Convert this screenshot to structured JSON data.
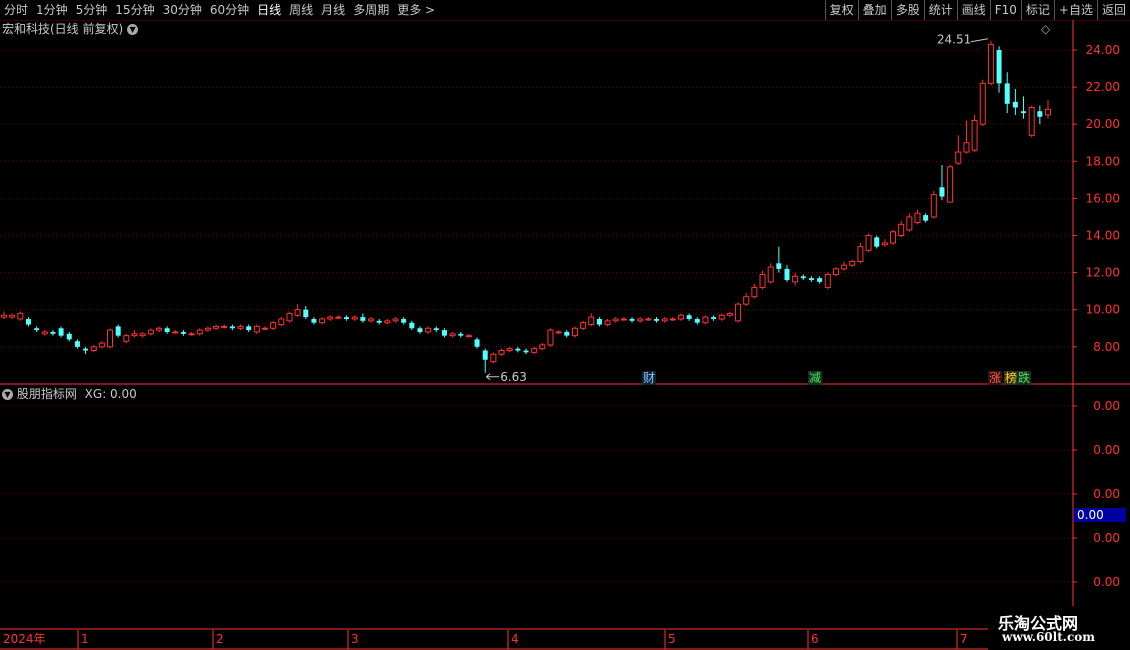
{
  "toolbar": {
    "left_items": [
      "分时",
      "1分钟",
      "5分钟",
      "15分钟",
      "30分钟",
      "60分钟",
      "日线",
      "周线",
      "月线",
      "多周期",
      "更多 >"
    ],
    "active": "日线",
    "right_items": [
      "复权",
      "叠加",
      "多股",
      "统计",
      "画线",
      "F10",
      "标记",
      "+自选",
      "返回"
    ]
  },
  "main_chart": {
    "title": "宏和科技(日线 前复权)",
    "title_icon": "chevron-down-icon",
    "corner_icon": "diamond-icon",
    "y_axis_labels": [
      "24.00",
      "22.00",
      "20.00",
      "18.00",
      "16.00",
      "14.00",
      "12.00",
      "10.00",
      "8.00"
    ],
    "high_label": "24.51",
    "low_label": "6.63",
    "badges": [
      {
        "text": "财",
        "color": "#7ec8ff"
      },
      {
        "text": "减",
        "color": "#55dd55"
      },
      {
        "text": "涨",
        "color": "#ff5555"
      },
      {
        "text": "榜",
        "color": "#ffcc33"
      },
      {
        "text": "跌",
        "color": "#55dd55"
      }
    ]
  },
  "indicator": {
    "title": "股朋指标网",
    "xg_label": "XG: 0.00",
    "y_axis_labels": [
      "0.00",
      "0.00",
      "0.00",
      "0.00",
      "0.00"
    ],
    "current_value": "0.00"
  },
  "time_axis": {
    "year": "2024年",
    "months": [
      "1",
      "2",
      "3",
      "4",
      "5",
      "6",
      "7"
    ]
  },
  "watermark": {
    "line1": "乐淘公式网",
    "line2": "www.60lt.com"
  },
  "colors": {
    "up": "#ff3232",
    "down": "#54ffff",
    "grid": "#8b0000",
    "axis": "#ff3232",
    "selected_bg": "#0000a0"
  },
  "chart_data": {
    "type": "candlestick",
    "title": "宏和科技(日线 前复权)",
    "ylim": [
      6.0,
      25.5
    ],
    "y_ticks": [
      8,
      10,
      12,
      14,
      16,
      18,
      20,
      22,
      24
    ],
    "annotations": [
      {
        "label": "24.51",
        "kind": "high"
      },
      {
        "label": "6.63",
        "kind": "low"
      }
    ],
    "candles": [
      [
        9.6,
        9.7,
        9.9,
        9.5
      ],
      [
        9.6,
        9.7,
        9.8,
        9.5
      ],
      [
        9.5,
        9.8,
        9.9,
        9.4
      ],
      [
        9.5,
        9.2,
        9.6,
        9.1
      ],
      [
        9.0,
        8.9,
        9.1,
        8.8
      ],
      [
        8.7,
        8.8,
        8.9,
        8.6
      ],
      [
        8.8,
        8.7,
        8.9,
        8.6
      ],
      [
        9.0,
        8.6,
        9.1,
        8.5
      ],
      [
        8.7,
        8.4,
        8.8,
        8.3
      ],
      [
        8.3,
        8.0,
        8.4,
        7.9
      ],
      [
        7.9,
        7.8,
        8.0,
        7.6
      ],
      [
        7.8,
        8.0,
        8.1,
        7.7
      ],
      [
        8.0,
        8.2,
        8.3,
        7.9
      ],
      [
        8.0,
        8.9,
        9.0,
        7.9
      ],
      [
        9.1,
        8.6,
        9.2,
        8.5
      ],
      [
        8.3,
        8.6,
        8.7,
        8.2
      ],
      [
        8.6,
        8.7,
        8.9,
        8.5
      ],
      [
        8.6,
        8.7,
        8.8,
        8.5
      ],
      [
        8.7,
        8.9,
        9.0,
        8.6
      ],
      [
        8.9,
        9.0,
        9.1,
        8.8
      ],
      [
        9.0,
        8.8,
        9.1,
        8.7
      ],
      [
        8.8,
        8.8,
        8.9,
        8.7
      ],
      [
        8.8,
        8.7,
        8.9,
        8.6
      ],
      [
        8.7,
        8.7,
        8.8,
        8.6
      ],
      [
        8.7,
        8.9,
        9.0,
        8.6
      ],
      [
        8.9,
        9.0,
        9.1,
        8.8
      ],
      [
        9.0,
        9.1,
        9.2,
        8.9
      ],
      [
        9.1,
        9.1,
        9.2,
        9.0
      ],
      [
        9.1,
        9.0,
        9.2,
        8.9
      ],
      [
        9.0,
        9.1,
        9.2,
        8.9
      ],
      [
        9.1,
        8.9,
        9.2,
        8.8
      ],
      [
        8.8,
        9.1,
        9.2,
        8.7
      ],
      [
        9.0,
        9.0,
        9.1,
        8.9
      ],
      [
        9.0,
        9.3,
        9.4,
        8.9
      ],
      [
        9.2,
        9.5,
        9.6,
        9.1
      ],
      [
        9.4,
        9.8,
        9.9,
        9.3
      ],
      [
        9.7,
        10.0,
        10.3,
        9.6
      ],
      [
        10.0,
        9.6,
        10.2,
        9.5
      ],
      [
        9.5,
        9.3,
        9.6,
        9.2
      ],
      [
        9.3,
        9.5,
        9.6,
        9.2
      ],
      [
        9.5,
        9.6,
        9.7,
        9.4
      ],
      [
        9.6,
        9.6,
        9.7,
        9.5
      ],
      [
        9.6,
        9.5,
        9.7,
        9.4
      ],
      [
        9.5,
        9.6,
        9.7,
        9.4
      ],
      [
        9.6,
        9.4,
        9.8,
        9.3
      ],
      [
        9.4,
        9.5,
        9.6,
        9.3
      ],
      [
        9.4,
        9.3,
        9.5,
        9.2
      ],
      [
        9.3,
        9.4,
        9.5,
        9.2
      ],
      [
        9.4,
        9.5,
        9.6,
        9.3
      ],
      [
        9.5,
        9.3,
        9.6,
        9.2
      ],
      [
        9.3,
        9.0,
        9.4,
        8.9
      ],
      [
        9.0,
        8.8,
        9.1,
        8.7
      ],
      [
        8.8,
        9.0,
        9.1,
        8.7
      ],
      [
        9.0,
        8.9,
        9.1,
        8.8
      ],
      [
        8.9,
        8.6,
        9.0,
        8.5
      ],
      [
        8.6,
        8.7,
        8.8,
        8.5
      ],
      [
        8.7,
        8.6,
        8.8,
        8.5
      ],
      [
        8.6,
        8.6,
        8.7,
        8.5
      ],
      [
        8.4,
        8.0,
        8.5,
        7.9
      ],
      [
        7.8,
        7.3,
        7.9,
        6.6
      ],
      [
        7.2,
        7.6,
        7.7,
        7.1
      ],
      [
        7.6,
        7.8,
        7.9,
        7.5
      ],
      [
        7.8,
        7.9,
        8.0,
        7.7
      ],
      [
        7.9,
        7.8,
        8.0,
        7.7
      ],
      [
        7.8,
        7.7,
        7.9,
        7.6
      ],
      [
        7.7,
        7.9,
        8.0,
        7.6
      ],
      [
        7.9,
        8.1,
        8.2,
        7.8
      ],
      [
        8.1,
        8.9,
        9.0,
        8.0
      ],
      [
        8.8,
        8.8,
        8.9,
        8.7
      ],
      [
        8.8,
        8.6,
        8.9,
        8.5
      ],
      [
        8.6,
        9.0,
        9.1,
        8.5
      ],
      [
        9.0,
        9.3,
        9.4,
        8.9
      ],
      [
        9.2,
        9.6,
        9.8,
        9.1
      ],
      [
        9.5,
        9.2,
        9.6,
        9.1
      ],
      [
        9.2,
        9.4,
        9.5,
        9.1
      ],
      [
        9.4,
        9.5,
        9.6,
        9.3
      ],
      [
        9.5,
        9.5,
        9.6,
        9.4
      ],
      [
        9.5,
        9.4,
        9.6,
        9.3
      ],
      [
        9.4,
        9.5,
        9.6,
        9.3
      ],
      [
        9.5,
        9.5,
        9.6,
        9.4
      ],
      [
        9.5,
        9.4,
        9.6,
        9.3
      ],
      [
        9.4,
        9.5,
        9.6,
        9.3
      ],
      [
        9.5,
        9.5,
        9.6,
        9.4
      ],
      [
        9.5,
        9.7,
        9.8,
        9.4
      ],
      [
        9.7,
        9.5,
        9.8,
        9.4
      ],
      [
        9.5,
        9.3,
        9.6,
        9.2
      ],
      [
        9.3,
        9.6,
        9.7,
        9.2
      ],
      [
        9.6,
        9.5,
        9.7,
        9.4
      ],
      [
        9.5,
        9.7,
        9.8,
        9.4
      ],
      [
        9.7,
        9.8,
        9.9,
        9.6
      ],
      [
        9.4,
        10.3,
        10.4,
        9.3
      ],
      [
        10.3,
        10.7,
        10.9,
        10.2
      ],
      [
        10.7,
        11.2,
        11.4,
        10.6
      ],
      [
        11.2,
        11.9,
        12.1,
        11.1
      ],
      [
        11.5,
        12.3,
        12.5,
        11.4
      ],
      [
        12.5,
        12.2,
        13.4,
        12.0
      ],
      [
        12.2,
        11.6,
        12.4,
        11.5
      ],
      [
        11.5,
        11.8,
        12.0,
        11.3
      ],
      [
        11.8,
        11.7,
        11.9,
        11.6
      ],
      [
        11.7,
        11.6,
        11.8,
        11.5
      ],
      [
        11.7,
        11.5,
        11.8,
        11.4
      ],
      [
        11.2,
        11.9,
        12.0,
        11.1
      ],
      [
        11.9,
        12.2,
        12.3,
        11.8
      ],
      [
        12.2,
        12.4,
        12.6,
        12.1
      ],
      [
        12.4,
        12.6,
        12.7,
        12.3
      ],
      [
        12.6,
        13.4,
        13.6,
        12.5
      ],
      [
        13.2,
        14.0,
        14.1,
        13.1
      ],
      [
        13.9,
        13.4,
        14.0,
        13.3
      ],
      [
        13.5,
        13.6,
        13.8,
        13.4
      ],
      [
        13.6,
        14.2,
        14.3,
        13.5
      ],
      [
        14.0,
        14.6,
        14.8,
        13.9
      ],
      [
        14.3,
        15.0,
        15.2,
        14.2
      ],
      [
        14.7,
        15.2,
        15.4,
        14.6
      ],
      [
        15.1,
        14.8,
        15.2,
        14.7
      ],
      [
        15.0,
        16.2,
        16.4,
        14.9
      ],
      [
        16.6,
        16.1,
        17.8,
        15.9
      ],
      [
        15.8,
        17.7,
        17.8,
        15.8
      ],
      [
        17.9,
        18.5,
        19.4,
        17.8
      ],
      [
        18.5,
        19.0,
        20.2,
        18.4
      ],
      [
        18.6,
        20.2,
        20.5,
        18.5
      ],
      [
        20.0,
        22.2,
        22.4,
        19.9
      ],
      [
        22.2,
        24.3,
        24.5,
        22.1
      ],
      [
        24.0,
        22.2,
        24.2,
        21.7
      ],
      [
        22.2,
        21.1,
        22.8,
        20.6
      ],
      [
        21.2,
        20.9,
        21.9,
        20.5
      ],
      [
        20.7,
        20.6,
        21.5,
        20.3
      ],
      [
        19.4,
        20.9,
        21.0,
        19.3
      ],
      [
        20.7,
        20.4,
        21.0,
        20.0
      ],
      [
        20.5,
        20.8,
        21.3,
        20.3
      ]
    ]
  }
}
